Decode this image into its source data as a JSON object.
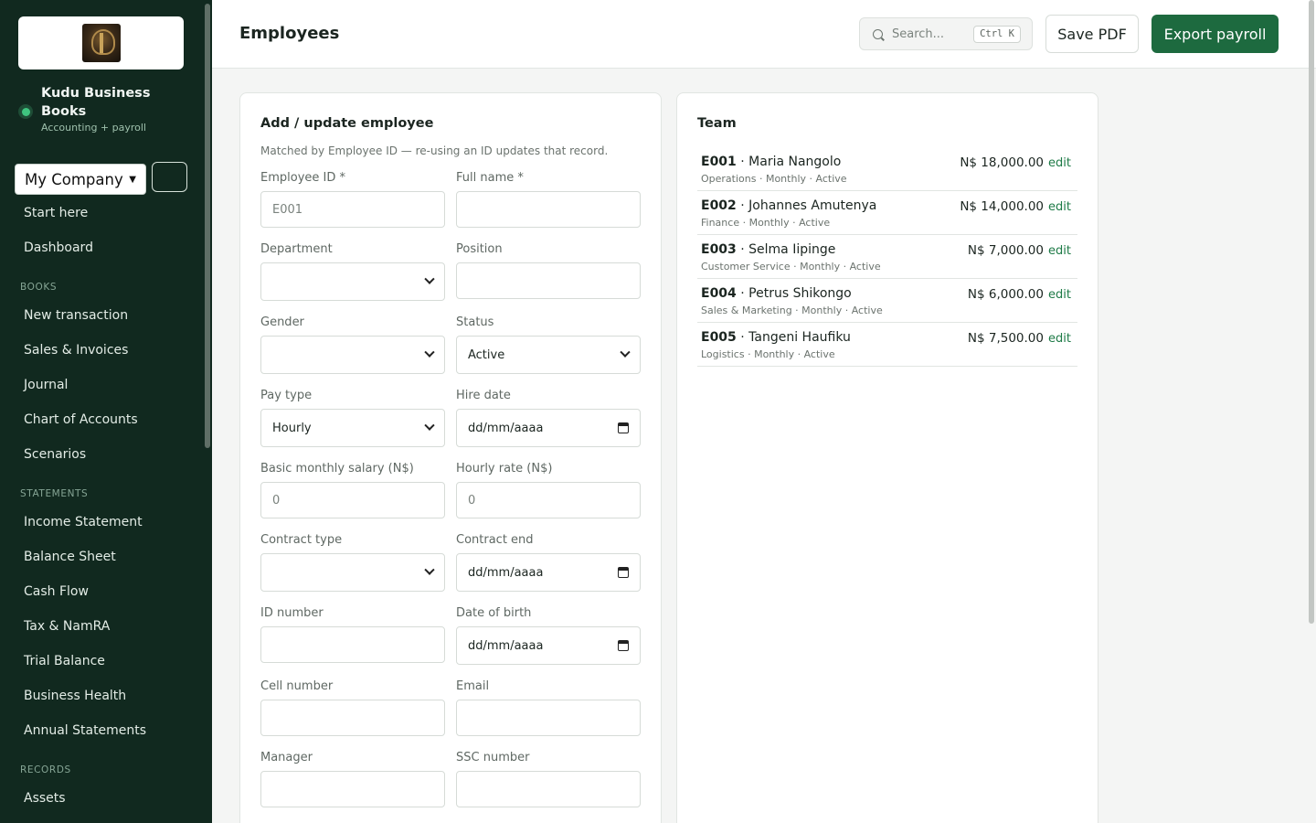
{
  "sidebar": {
    "brand_name": "Kudu Business Books",
    "brand_sub": "Accounting + payroll",
    "company_select": "My Company",
    "nav_top": [
      "Start here",
      "Dashboard"
    ],
    "sections": {
      "books": "BOOKS",
      "statements": "STATEMENTS",
      "records": "RECORDS"
    },
    "books_items": [
      "New transaction",
      "Sales & Invoices",
      "Journal",
      "Chart of Accounts",
      "Scenarios"
    ],
    "statements_items": [
      "Income Statement",
      "Balance Sheet",
      "Cash Flow",
      "Tax & NamRA",
      "Trial Balance",
      "Business Health",
      "Annual Statements"
    ],
    "records_items": [
      "Assets"
    ]
  },
  "header": {
    "title": "Employees",
    "search_placeholder": "Search...",
    "search_shortcut": "Ctrl K",
    "save_pdf": "Save PDF",
    "export_payroll": "Export payroll"
  },
  "form": {
    "title": "Add / update employee",
    "note": "Matched by Employee ID — re-using an ID updates that record.",
    "fields": {
      "employee_id": {
        "label": "Employee ID *",
        "placeholder": "E001"
      },
      "full_name": {
        "label": "Full name *",
        "value": ""
      },
      "department": {
        "label": "Department",
        "value": ""
      },
      "position": {
        "label": "Position",
        "value": ""
      },
      "gender": {
        "label": "Gender",
        "value": ""
      },
      "status": {
        "label": "Status",
        "value": "Active"
      },
      "pay_type": {
        "label": "Pay type",
        "value": "Hourly"
      },
      "hire_date": {
        "label": "Hire date",
        "value": "dd/mm/aaaa"
      },
      "basic_salary": {
        "label": "Basic monthly salary (N$)",
        "placeholder": "0"
      },
      "hourly_rate": {
        "label": "Hourly rate (N$)",
        "placeholder": "0"
      },
      "contract_type": {
        "label": "Contract type",
        "value": ""
      },
      "contract_end": {
        "label": "Contract end",
        "value": "dd/mm/aaaa"
      },
      "id_number": {
        "label": "ID number",
        "value": ""
      },
      "date_of_birth": {
        "label": "Date of birth",
        "value": "dd/mm/aaaa"
      },
      "cell_number": {
        "label": "Cell number",
        "value": ""
      },
      "email": {
        "label": "Email",
        "value": ""
      },
      "manager": {
        "label": "Manager",
        "value": ""
      },
      "ssc_number": {
        "label": "SSC number",
        "value": ""
      }
    }
  },
  "team": {
    "title": "Team",
    "edit_label": "edit",
    "members": [
      {
        "id": "E001",
        "name": "Maria Nangolo",
        "meta": "Operations · Monthly · Active",
        "amount": "N$ 18,000.00"
      },
      {
        "id": "E002",
        "name": "Johannes Amutenya",
        "meta": "Finance · Monthly · Active",
        "amount": "N$ 14,000.00"
      },
      {
        "id": "E003",
        "name": "Selma Iipinge",
        "meta": "Customer Service · Monthly · Active",
        "amount": "N$ 7,000.00"
      },
      {
        "id": "E004",
        "name": "Petrus Shikongo",
        "meta": "Sales & Marketing · Monthly · Active",
        "amount": "N$ 6,000.00"
      },
      {
        "id": "E005",
        "name": "Tangeni Haufiku",
        "meta": "Logistics · Monthly · Active",
        "amount": "N$ 7,500.00"
      }
    ]
  },
  "colors": {
    "sidebar_bg": "#11291f",
    "accent": "#1d6a3f",
    "link": "#1d7a46"
  }
}
